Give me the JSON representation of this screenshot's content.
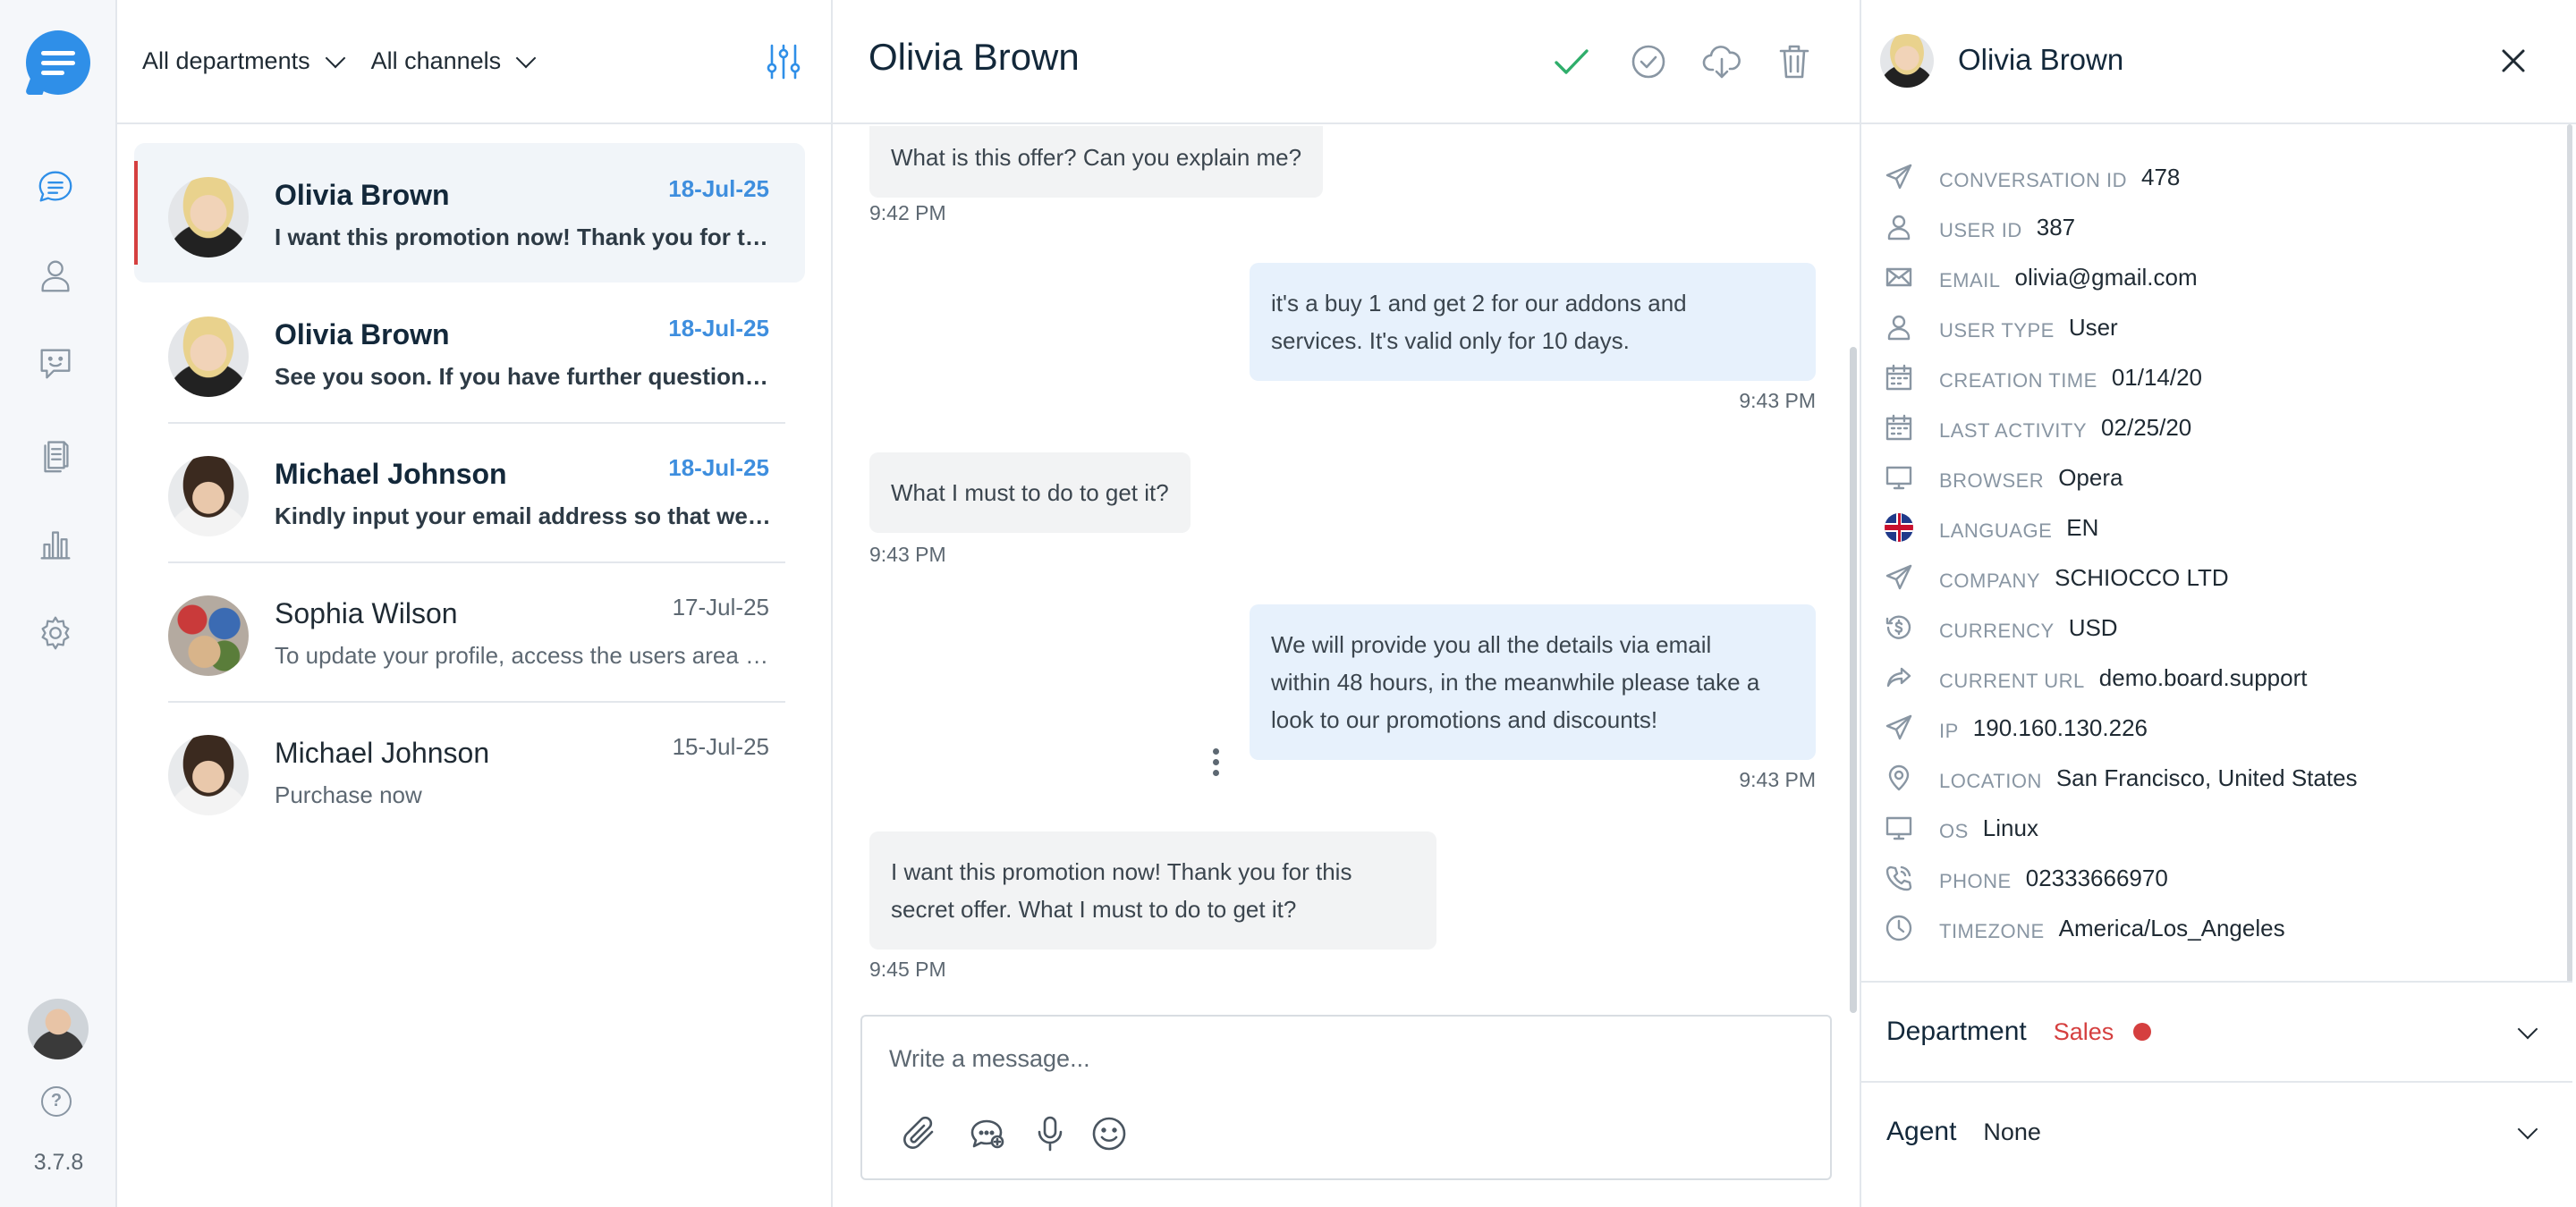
{
  "app": {
    "version": "3.7.8"
  },
  "list": {
    "filters": {
      "departments": "All departments",
      "channels": "All channels"
    },
    "conversations": [
      {
        "name": "Olivia Brown",
        "date": "18-Jul-25",
        "preview": "I want this promotion now! Thank you for this secret offer.",
        "unread": true,
        "active": true
      },
      {
        "name": "Olivia Brown",
        "date": "18-Jul-25",
        "preview": "See you soon. If you have further questions, please contact us.",
        "unread": true
      },
      {
        "name": "Michael Johnson",
        "date": "18-Jul-25",
        "preview": "Kindly input your email address so that we can contact you.",
        "unread": true
      },
      {
        "name": "Sophia Wilson",
        "date": "17-Jul-25",
        "preview": "To update your profile, access the users area and edit your details.",
        "unread": false
      },
      {
        "name": "Michael Johnson",
        "date": "15-Jul-25",
        "preview": "Purchase now",
        "unread": false
      }
    ]
  },
  "chat": {
    "title": "Olivia Brown",
    "messages": [
      {
        "dir": "in",
        "text": "What is this offer? Can you explain me?",
        "time": "9:42 PM"
      },
      {
        "dir": "out",
        "line1": "it's a buy 1 and get 2 for our addons and",
        "line2": "services. It's valid only for 10 days.",
        "time": "9:43 PM"
      },
      {
        "dir": "in",
        "text": "What I must to do to get it?",
        "time": "9:43 PM"
      },
      {
        "dir": "out",
        "line1": "We will provide you all the details via email",
        "line2": "within 48 hours, in the meanwhile please take a",
        "line3": "look to our promotions and discounts!",
        "time": "9:43 PM"
      },
      {
        "dir": "in",
        "line1": "I want this promotion now! Thank you for this",
        "line2": "secret offer. What I must to do to get it?",
        "time": "9:45 PM"
      }
    ],
    "composer": {
      "placeholder": "Write a message..."
    }
  },
  "details": {
    "name": "Olivia Brown",
    "fields": [
      {
        "label": "Conversation ID",
        "value": "478",
        "icon": "send-icon"
      },
      {
        "label": "User ID",
        "value": "387",
        "icon": "user-icon"
      },
      {
        "label": "Email",
        "value": "olivia@gmail.com",
        "icon": "mail-icon"
      },
      {
        "label": "User type",
        "value": "User",
        "icon": "user-icon"
      },
      {
        "label": "Creation time",
        "value": "01/14/20",
        "icon": "calendar-icon"
      },
      {
        "label": "Last activity",
        "value": "02/25/20",
        "icon": "calendar-icon"
      },
      {
        "label": "Browser",
        "value": "Opera",
        "icon": "monitor-icon"
      },
      {
        "label": "Language",
        "value": "EN",
        "icon": "uk-flag-icon"
      },
      {
        "label": "Company",
        "value": "SCHIOCCO LTD",
        "icon": "send-icon"
      },
      {
        "label": "Currency",
        "value": "USD",
        "icon": "currency-icon"
      },
      {
        "label": "Current URL",
        "value": "demo.board.support",
        "icon": "share-icon"
      },
      {
        "label": "IP",
        "value": "190.160.130.226",
        "icon": "send-icon"
      },
      {
        "label": "Location",
        "value": "San Francisco, United States",
        "icon": "location-icon"
      },
      {
        "label": "OS",
        "value": "Linux",
        "icon": "monitor-icon"
      },
      {
        "label": "Phone",
        "value": "02333666970",
        "icon": "phone-icon"
      },
      {
        "label": "Timezone",
        "value": "America/Los_Angeles",
        "icon": "clock-icon"
      }
    ],
    "department": {
      "title": "Department",
      "value": "Sales",
      "color": "#d53f3f"
    },
    "agent": {
      "title": "Agent",
      "value": "None"
    }
  }
}
